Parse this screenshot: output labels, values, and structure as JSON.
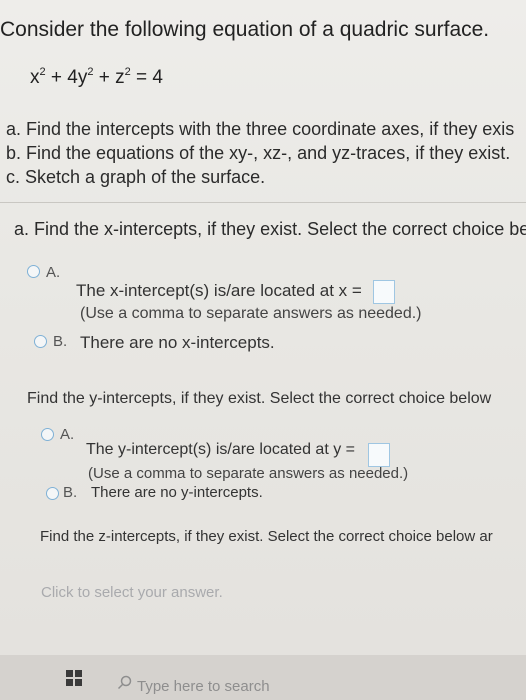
{
  "problem": {
    "title": "Consider the following equation of a quadric surface.",
    "equation": {
      "t1": "x",
      "e1": "2",
      "t2": " + 4y",
      "e2": "2",
      "t3": " + z",
      "e3": "2",
      "t4": " = 4"
    },
    "parts": [
      "a. Find the intercepts with the three coordinate axes, if they exis",
      "b. Find the equations of the xy-, xz-, and yz-traces, if they exist.",
      "c. Sketch a graph of the surface."
    ]
  },
  "question_x": {
    "prompt": "a. Find the x-intercepts, if they exist. Select the correct choice be",
    "option_a_letter": "A.",
    "option_a_text": "The x-intercept(s) is/are located at x =",
    "option_a_note": "(Use a comma to separate answers as needed.)",
    "option_b_letter": "B.",
    "option_b_text": "There are no x-intercepts."
  },
  "question_y": {
    "prompt": "Find the y-intercepts, if they exist. Select the correct choice below",
    "option_a_letter": "A.",
    "option_a_text": "The y-intercept(s) is/are located at y =",
    "option_a_note": "(Use a comma to separate answers as needed.)",
    "option_b_letter": "B.",
    "option_b_text": "There are no y-intercepts."
  },
  "question_z": {
    "prompt": "Find the z-intercepts, if they exist. Select the correct choice below ar"
  },
  "status": {
    "click_hint": "Click to select your answer."
  },
  "taskbar": {
    "search_placeholder": "Type here to search",
    "start_icon": "windows-start-icon",
    "search_icon": "search-icon"
  },
  "colors": {
    "accent": "#7fb1d6",
    "background": "#eeedea"
  }
}
